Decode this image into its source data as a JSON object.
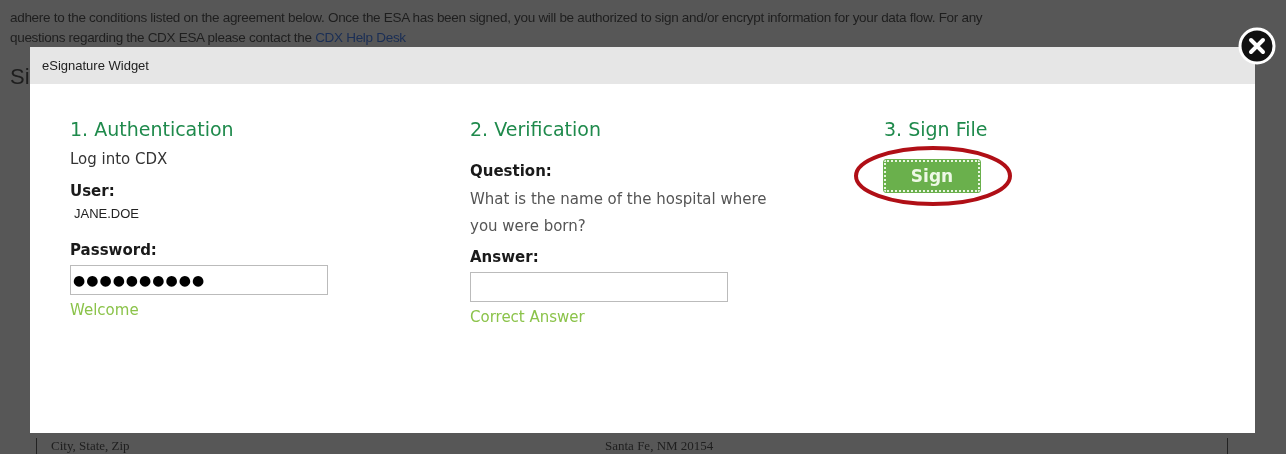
{
  "background": {
    "paragraph": "adhere to the conditions listed on the agreement below. Once the ESA has been signed, you will be authorized to sign and/or encrypt information for your data flow. For any",
    "paragraph_2": "questions regarding the CDX ESA please contact the",
    "help_link": "CDX Help Desk",
    "heading": "Si",
    "address_label": "City, State, Zip",
    "address_value": "Santa Fe, NM 20154"
  },
  "dialog": {
    "title": "eSignature Widget",
    "steps": [
      {
        "kind": "auth",
        "title": "1. Authentication",
        "subtitle": "Log into CDX",
        "user_label": "User:",
        "user": "JANE.DOE",
        "password_label": "Password:",
        "password": "●●●●●●●●●●",
        "status": "Welcome"
      },
      {
        "kind": "verify",
        "title": "2. Verification",
        "question_label": "Question:",
        "question": "What is the name of the hospital where you were born?",
        "answer_label": "Answer:",
        "status": "Correct Answer"
      },
      {
        "kind": "sign",
        "title": "3. Sign File",
        "button": "Sign",
        "highlighted": true
      }
    ]
  }
}
